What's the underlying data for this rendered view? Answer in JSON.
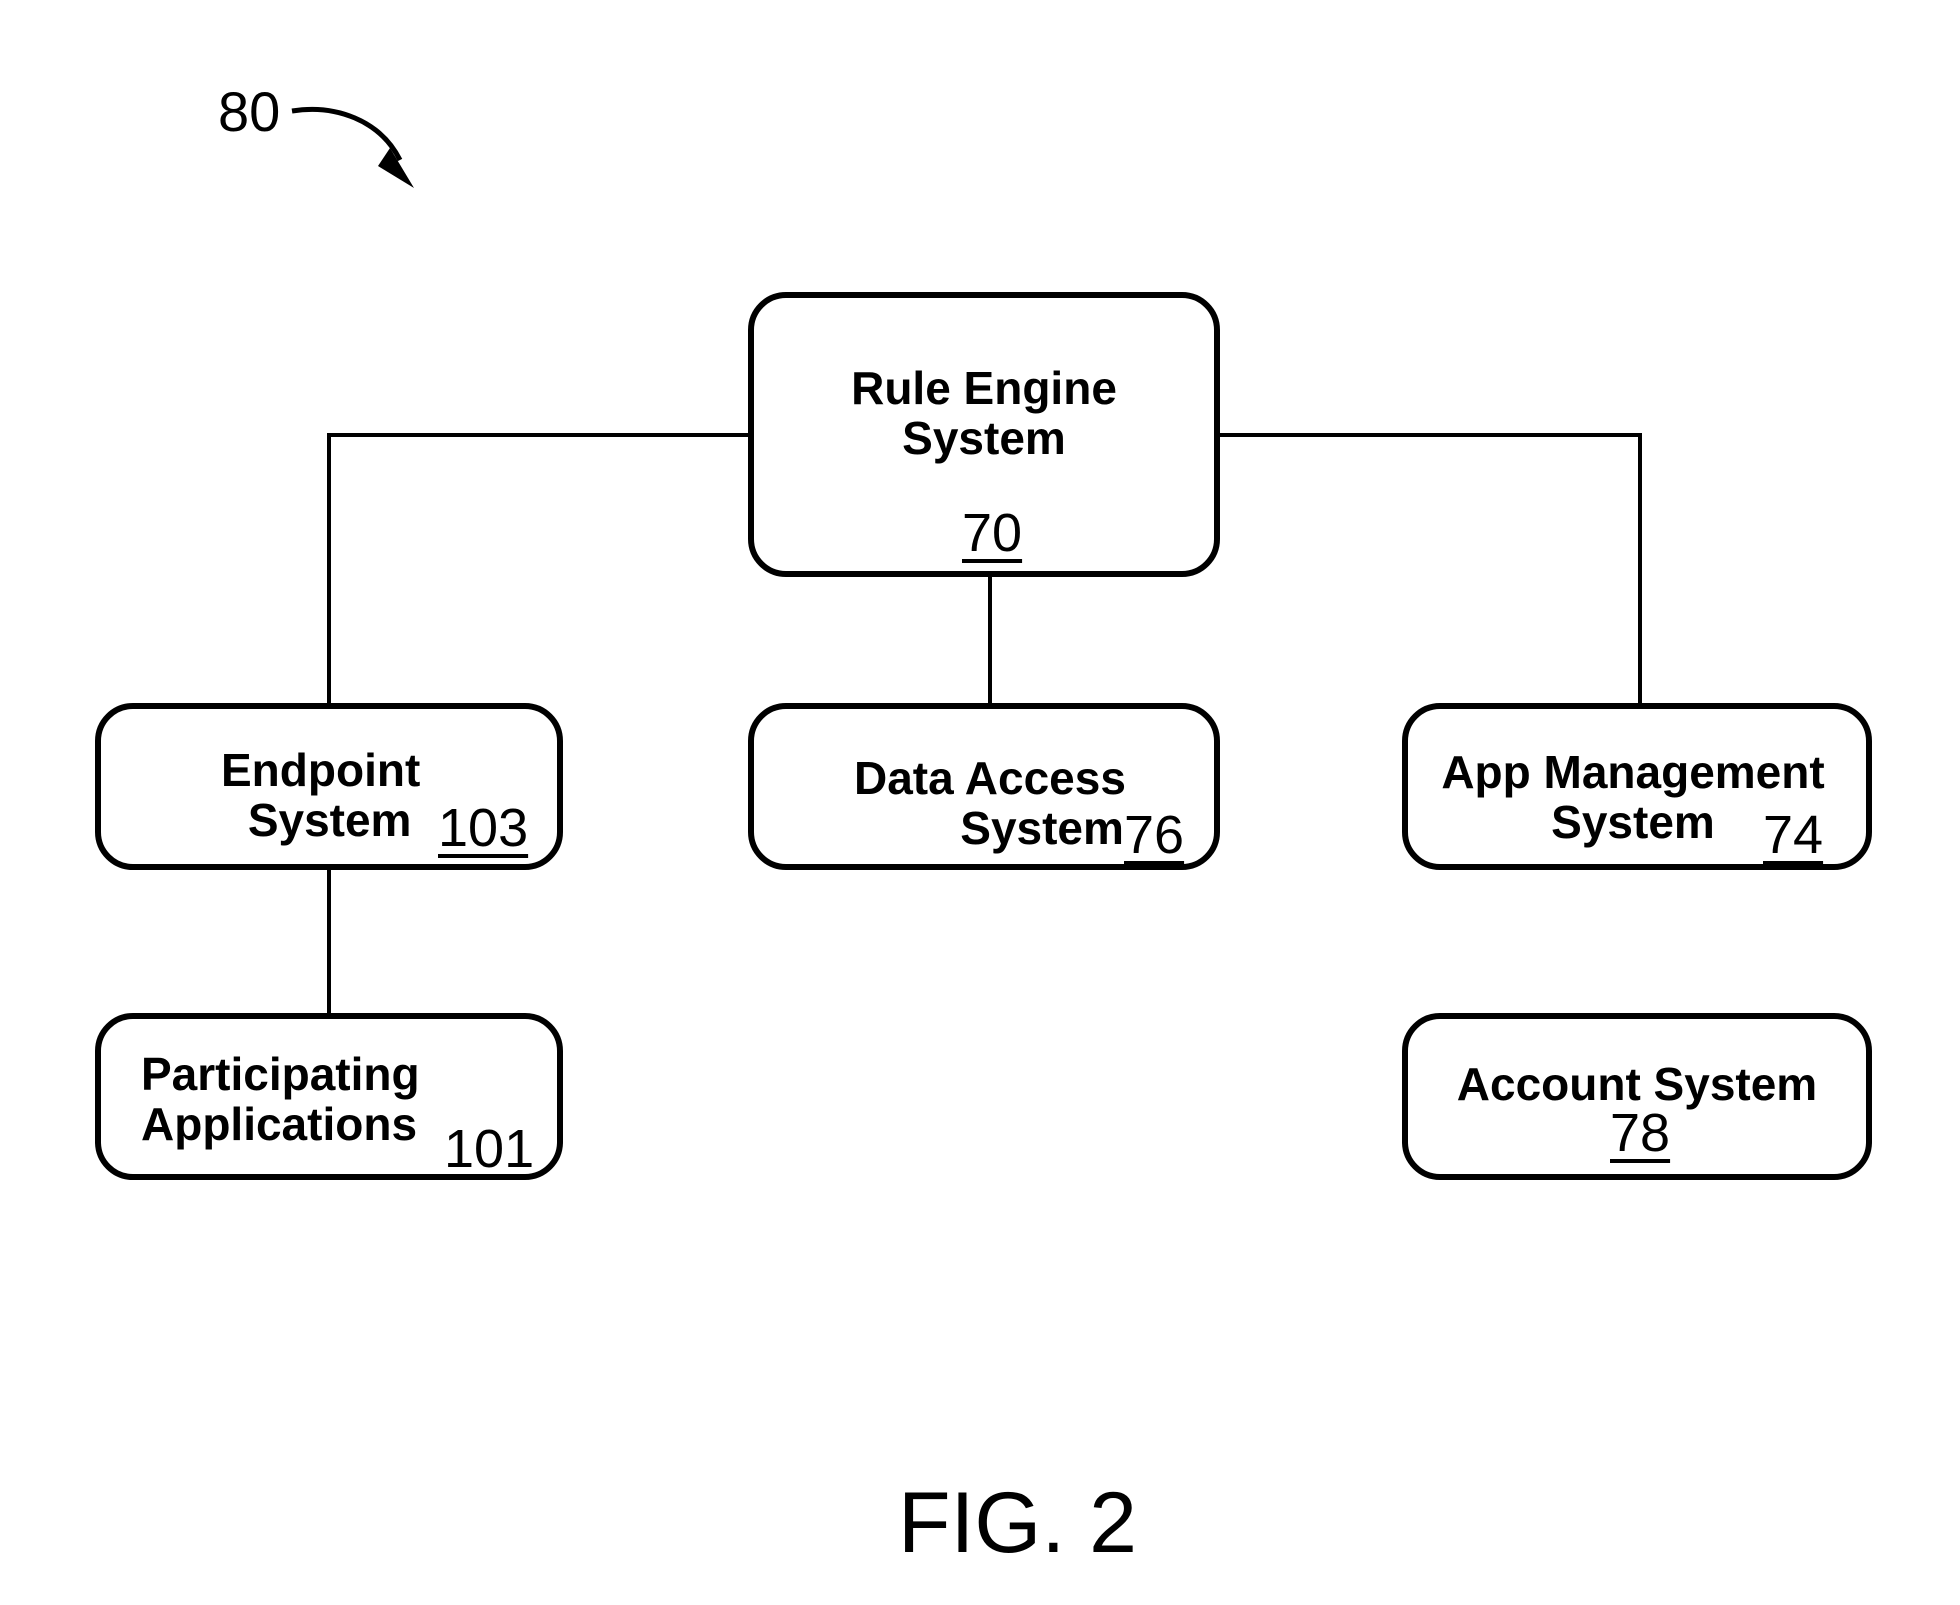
{
  "figure": {
    "reference": "80",
    "caption": "FIG. 2"
  },
  "nodes": {
    "rule_engine": {
      "line1": "Rule Engine",
      "line2": "System",
      "ref": "70"
    },
    "endpoint": {
      "line1": "Endpoint",
      "line2": "System",
      "ref": "103"
    },
    "data_access": {
      "line1": "Data Access",
      "line2": "System",
      "ref": "76"
    },
    "app_management": {
      "line1": "App Management",
      "line2": "System",
      "ref": "74"
    },
    "participating_apps": {
      "line1": "Participating",
      "line2": "Applications",
      "ref": "101"
    },
    "account": {
      "line1": "Account System",
      "ref": "78"
    }
  },
  "edges": [
    {
      "from": "rule_engine",
      "to": "endpoint"
    },
    {
      "from": "rule_engine",
      "to": "data_access"
    },
    {
      "from": "rule_engine",
      "to": "app_management"
    },
    {
      "from": "endpoint",
      "to": "participating_apps"
    }
  ]
}
